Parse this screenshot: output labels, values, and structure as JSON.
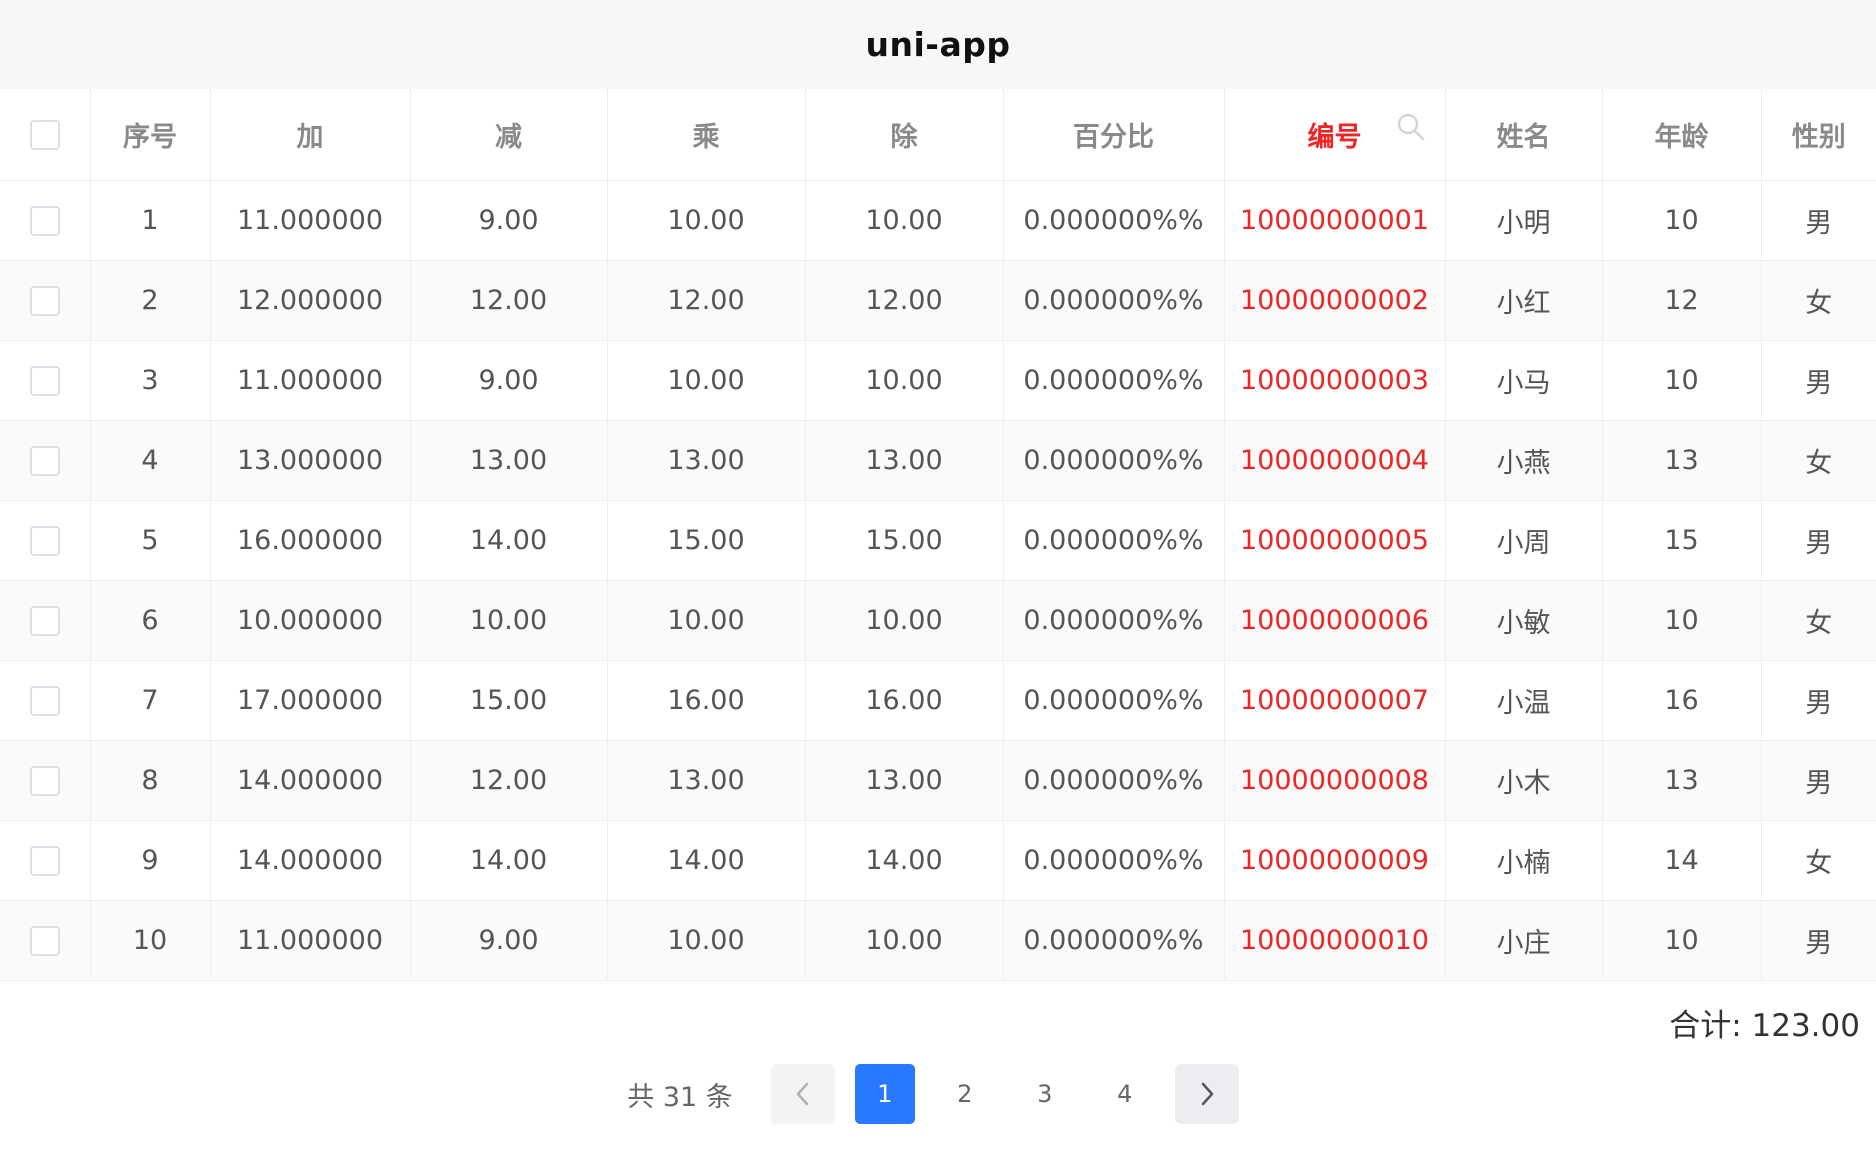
{
  "navbar": {
    "title": "uni-app"
  },
  "table": {
    "columns": [
      "序号",
      "加",
      "减",
      "乘",
      "除",
      "百分比",
      "编号",
      "姓名",
      "年龄",
      "性别"
    ],
    "rows": [
      [
        "1",
        "11.000000",
        "9.00",
        "10.00",
        "10.00",
        "0.000000%%",
        "10000000001",
        "小明",
        "10",
        "男"
      ],
      [
        "2",
        "12.000000",
        "12.00",
        "12.00",
        "12.00",
        "0.000000%%",
        "10000000002",
        "小红",
        "12",
        "女"
      ],
      [
        "3",
        "11.000000",
        "9.00",
        "10.00",
        "10.00",
        "0.000000%%",
        "10000000003",
        "小马",
        "10",
        "男"
      ],
      [
        "4",
        "13.000000",
        "13.00",
        "13.00",
        "13.00",
        "0.000000%%",
        "10000000004",
        "小燕",
        "13",
        "女"
      ],
      [
        "5",
        "16.000000",
        "14.00",
        "15.00",
        "15.00",
        "0.000000%%",
        "10000000005",
        "小周",
        "15",
        "男"
      ],
      [
        "6",
        "10.000000",
        "10.00",
        "10.00",
        "10.00",
        "0.000000%%",
        "10000000006",
        "小敏",
        "10",
        "女"
      ],
      [
        "7",
        "17.000000",
        "15.00",
        "16.00",
        "16.00",
        "0.000000%%",
        "10000000007",
        "小温",
        "16",
        "男"
      ],
      [
        "8",
        "14.000000",
        "12.00",
        "13.00",
        "13.00",
        "0.000000%%",
        "10000000008",
        "小木",
        "13",
        "男"
      ],
      [
        "9",
        "14.000000",
        "14.00",
        "14.00",
        "14.00",
        "0.000000%%",
        "10000000009",
        "小楠",
        "14",
        "女"
      ],
      [
        "10",
        "11.000000",
        "9.00",
        "10.00",
        "10.00",
        "0.000000%%",
        "10000000010",
        "小庄",
        "10",
        "男"
      ]
    ]
  },
  "summary": {
    "text": "合计: 123.00"
  },
  "pagination": {
    "total_label": "共 31 条",
    "pages": [
      "1",
      "2",
      "3",
      "4"
    ],
    "current_page": "1"
  },
  "icons": {
    "search": "search-icon",
    "prev": "chevron-left-icon",
    "next": "chevron-right-icon"
  },
  "colors": {
    "accent_red": "#f02424",
    "active_blue": "#2979ff"
  }
}
